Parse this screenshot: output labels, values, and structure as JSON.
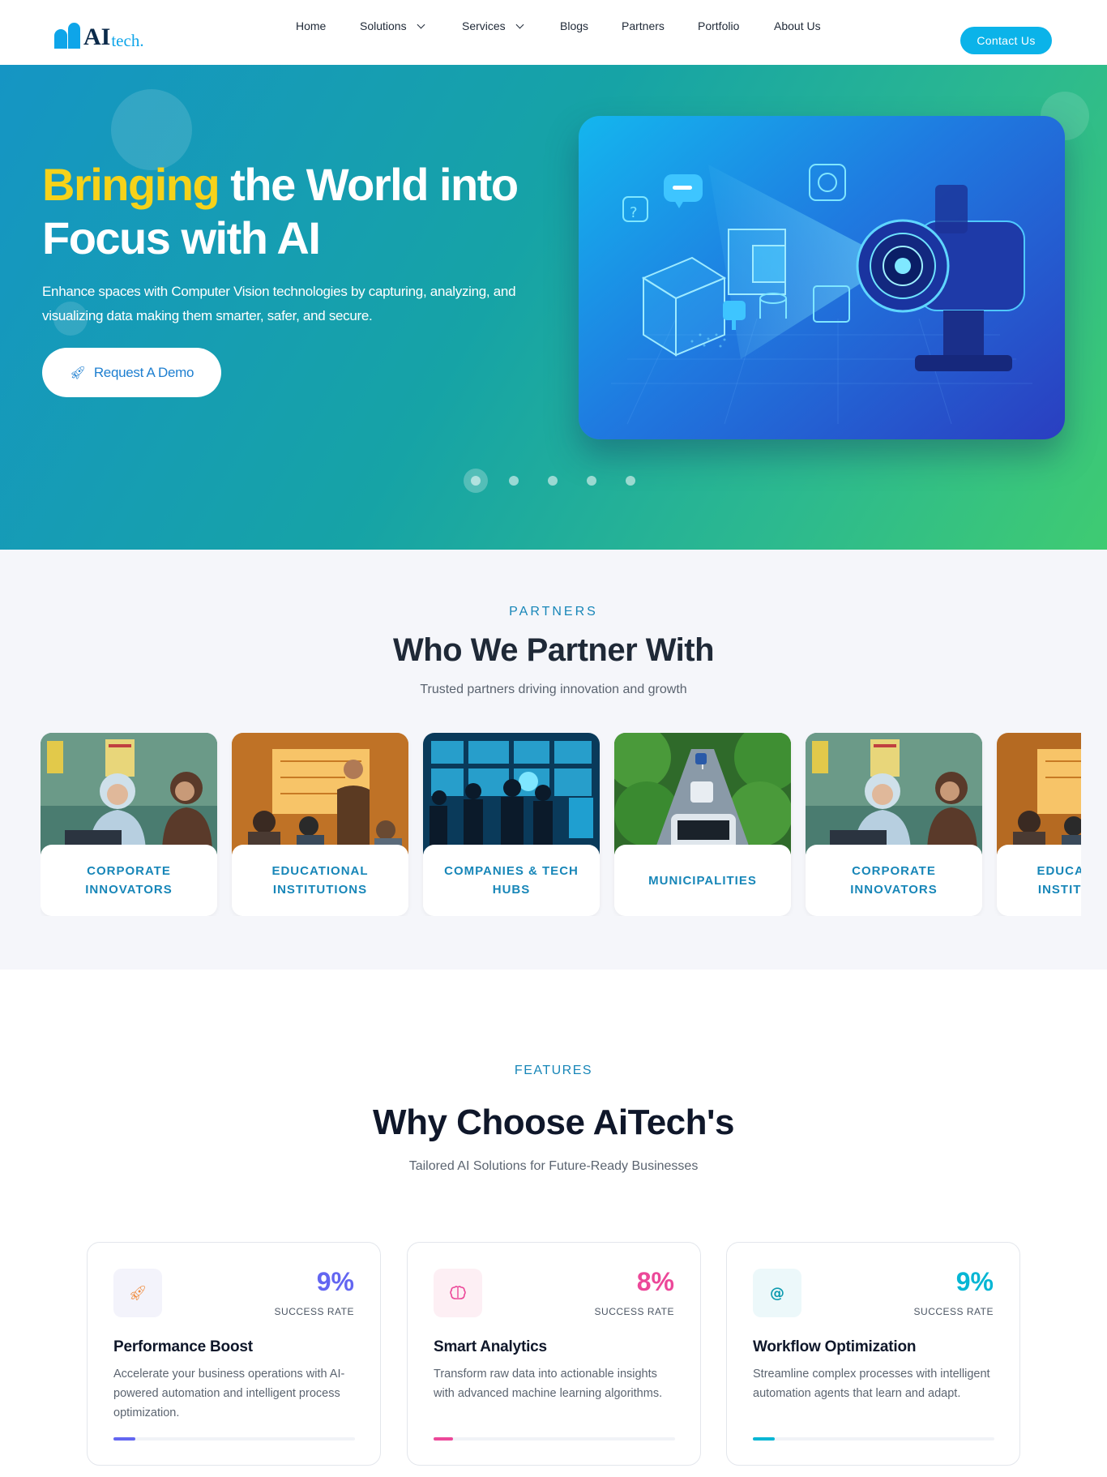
{
  "nav": {
    "logo_ai": "AI",
    "logo_tech": "tech.",
    "items": [
      {
        "label": "Home"
      },
      {
        "label": "Solutions"
      },
      {
        "label": "Services"
      },
      {
        "label": "Blogs"
      },
      {
        "label": "Partners"
      },
      {
        "label": "Portfolio"
      },
      {
        "label": "About Us"
      }
    ],
    "contact_label": "Contact Us"
  },
  "hero": {
    "title_highlight": "Bringing",
    "title_rest_1": " the World into",
    "title_line2": "Focus with AI",
    "subtitle": "Enhance spaces with Computer Vision technologies by capturing, analyzing, and visualizing data making them smarter, safer, and secure.",
    "cta_label": "Request A Demo",
    "cta_icon": "rocket-icon",
    "slides_total": 5,
    "active_slide": 1,
    "colors": {
      "highlight": "#f6d21a",
      "gradient_start": "#1595c4",
      "gradient_end": "#3fcb72"
    }
  },
  "partners": {
    "eyebrow": "PARTNERS",
    "title": "Who We Partner With",
    "subtitle": "Trusted partners driving innovation and growth",
    "cards": [
      {
        "label": "Corporate Innovators"
      },
      {
        "label": "Educational Institutions"
      },
      {
        "label": "Companies & Tech Hubs"
      },
      {
        "label": "Municipalities"
      },
      {
        "label": "Corporate Innovators"
      },
      {
        "label": "Educational Institutions"
      }
    ]
  },
  "features": {
    "eyebrow": "FEATURES",
    "title": "Why Choose AiTech's",
    "subtitle": "Tailored AI Solutions for Future-Ready Businesses",
    "cards": [
      {
        "icon": "rocket-icon",
        "percent": "9%",
        "rate_label": "SUCCESS RATE",
        "name": "Performance Boost",
        "description": "Accelerate your business operations with AI-powered automation and intelligent process optimization.",
        "color": "#6366f1",
        "progress": 0.09
      },
      {
        "icon": "brain-icon",
        "percent": "8%",
        "rate_label": "SUCCESS RATE",
        "name": "Smart Analytics",
        "description": "Transform raw data into actionable insights with advanced machine learning algorithms.",
        "color": "#ec4899",
        "progress": 0.08
      },
      {
        "icon": "at-sign-icon",
        "percent": "9%",
        "rate_label": "SUCCESS RATE",
        "name": "Workflow Optimization",
        "description": "Streamline complex processes with intelligent automation agents that learn and adapt.",
        "color": "#06b6d4",
        "progress": 0.09
      }
    ]
  }
}
